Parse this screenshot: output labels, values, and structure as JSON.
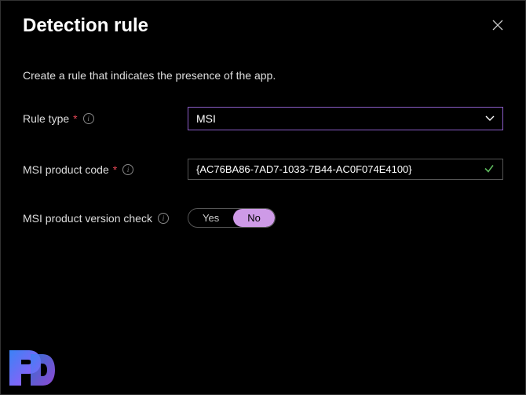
{
  "header": {
    "title": "Detection rule"
  },
  "subtitle": "Create a rule that indicates the presence of the app.",
  "ruleType": {
    "label": "Rule type",
    "value": "MSI"
  },
  "productCode": {
    "label": "MSI product code",
    "value": "{AC76BA86-7AD7-1033-7B44-AC0F074E4100}"
  },
  "versionCheck": {
    "label": "MSI product version check",
    "yes": "Yes",
    "no": "No",
    "selected": "No"
  }
}
